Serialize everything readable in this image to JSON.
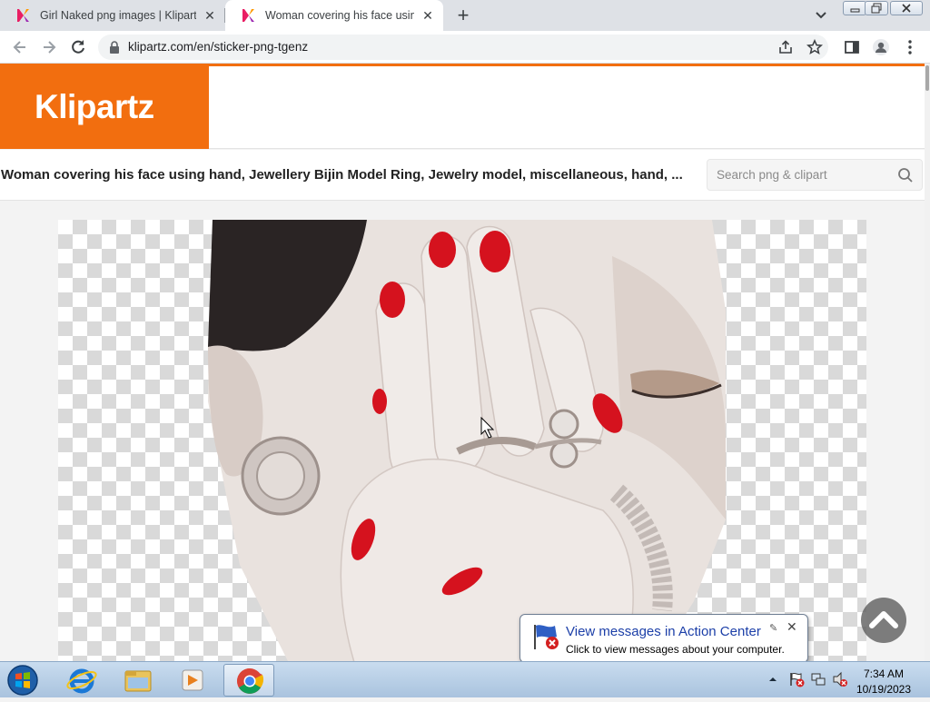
{
  "browser": {
    "tabs": [
      {
        "title": "Girl Naked png images | Klipartz",
        "active": false
      },
      {
        "title": "Woman covering his face using h",
        "active": true
      }
    ],
    "new_tab_label": "+",
    "url": "klipartz.com/en/sticker-png-tgenz"
  },
  "site": {
    "logo": "Klipartz",
    "brand_color": "#f26e0f",
    "page_title": "Woman covering his face using hand, Jewellery Bijin Model Ring, Jewelry model, miscellaneous, hand, ...",
    "search": {
      "placeholder": "Search png & clipart",
      "value": ""
    }
  },
  "notification": {
    "title": "View messages in Action Center",
    "text": "Click to view messages about your computer."
  },
  "taskbar": {
    "apps": [
      "start-orb-icon",
      "internet-explorer-icon",
      "file-explorer-icon",
      "media-player-icon",
      "chrome-icon"
    ],
    "clock_time": "7:34 AM",
    "clock_date": "10/19/2023"
  }
}
